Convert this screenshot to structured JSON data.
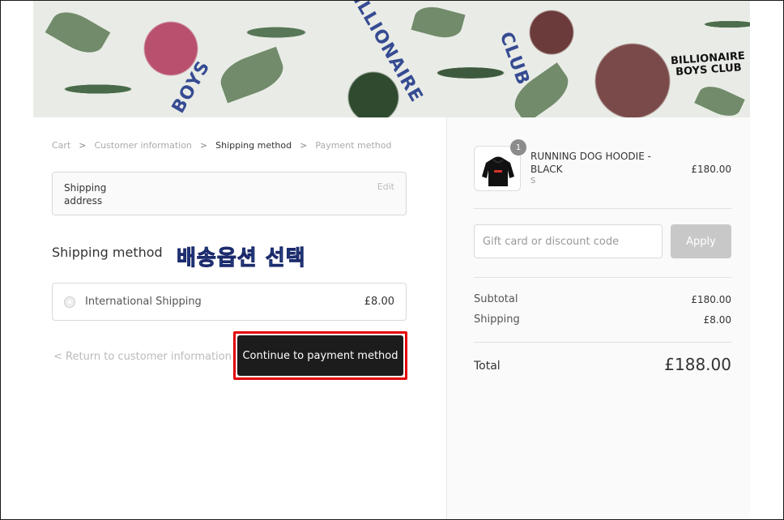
{
  "breadcrumb": {
    "items": [
      "Cart",
      "Customer information",
      "Shipping method",
      "Payment method"
    ],
    "separator": ">"
  },
  "shipping_address": {
    "label": "Shipping address",
    "edit_label": "Edit"
  },
  "shipping_method": {
    "title": "Shipping method",
    "annotation": "배송옵션 선택",
    "option_name": "International Shipping",
    "option_price": "£8.00"
  },
  "actions": {
    "return_label": "< Return to customer information",
    "continue_label": "Continue to payment method"
  },
  "order": {
    "quantity": "1",
    "product_name": "RUNNING DOG HOODIE - BLACK",
    "variant": "S",
    "price": "£180.00"
  },
  "discount": {
    "placeholder": "Gift card or discount code",
    "apply_label": "Apply"
  },
  "summary": {
    "subtotal_label": "Subtotal",
    "subtotal_value": "£180.00",
    "shipping_label": "Shipping",
    "shipping_value": "£8.00",
    "total_label": "Total",
    "total_value": "£188.00"
  },
  "banner": {
    "logo_text": "BILLIONAIRE BOYS CLUB"
  },
  "colors": {
    "accent_red": "#e10000",
    "button_dark": "#1c1c1c",
    "annotation_blue": "#3fb5e8"
  }
}
